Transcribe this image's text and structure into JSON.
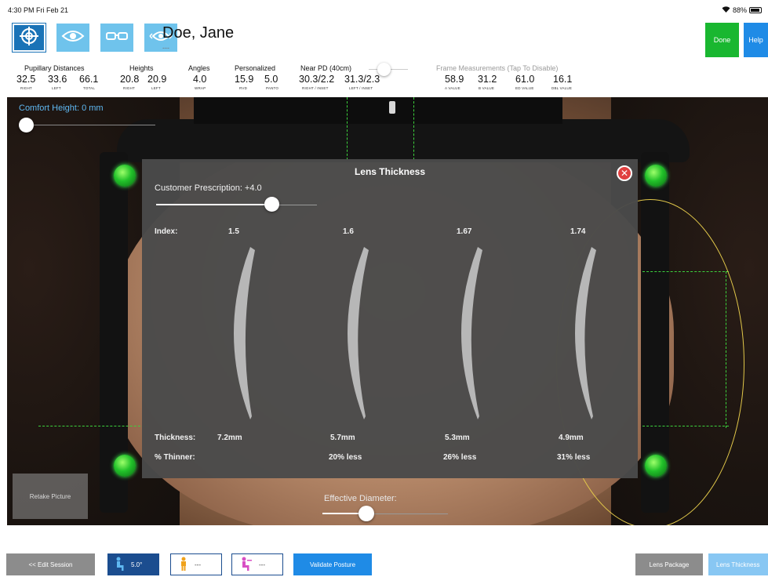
{
  "status": {
    "time": "4:30 PM  Fri Feb 21",
    "battery": "88%",
    "battery_level": 0.88
  },
  "header": {
    "patient_name": "Doe, Jane",
    "patient_sub": "---",
    "mode_tabs": [
      "target-icon",
      "eye-icon",
      "glasses-icon",
      "eye-arrows-icon"
    ],
    "done_label": "Done",
    "help_label": "Help"
  },
  "measurements": {
    "pd": {
      "title": "Pupillary Distances",
      "values": [
        "32.5",
        "33.6",
        "66.1"
      ],
      "subs": [
        "RIGHT",
        "LEFT",
        "TOTAL"
      ]
    },
    "heights": {
      "title": "Heights",
      "values": [
        "20.8",
        "20.9"
      ],
      "subs": [
        "RIGHT",
        "LEFT"
      ]
    },
    "angles": {
      "title": "Angles",
      "values": [
        "4.0"
      ],
      "subs": [
        "WRAP"
      ]
    },
    "personalized": {
      "title": "Personalized",
      "values": [
        "15.9",
        "5.0"
      ],
      "subs": [
        "RVD",
        "PANTO"
      ]
    },
    "near": {
      "title": "Near PD (40cm)",
      "values": [
        "30.3/2.2",
        "31.3/2.3"
      ],
      "subs": [
        "RIGHT / INSET",
        "LEFT / INSET"
      ]
    },
    "frame": {
      "title": "Frame Measurements (Tap To Disable)",
      "values": [
        "58.9",
        "31.2",
        "61.0",
        "16.1"
      ],
      "subs": [
        "A VALUE",
        "B VALUE",
        "ED VALUE",
        "DBL VALUE"
      ]
    }
  },
  "comfort_height_label": "Comfort Height: 0 mm",
  "retake_label": "Retake Picture",
  "effective_diameter_label": "Effective Diameter:",
  "modal": {
    "title": "Lens Thickness",
    "prescription_label": "Customer Prescription: +4.0",
    "prescription_fraction": 0.72,
    "index_label": "Index:",
    "thickness_label": "Thickness:",
    "thinner_label": "% Thinner:",
    "lenses": [
      {
        "index": "1.5",
        "thickness": "7.2mm",
        "thinner": "",
        "thickness_mm": 7.2
      },
      {
        "index": "1.6",
        "thickness": "5.7mm",
        "thinner": "20% less",
        "thickness_mm": 5.7
      },
      {
        "index": "1.67",
        "thickness": "5.3mm",
        "thinner": "26% less",
        "thickness_mm": 5.3
      },
      {
        "index": "1.74",
        "thickness": "4.9mm",
        "thinner": "31% less",
        "thickness_mm": 4.9
      }
    ]
  },
  "bottom": {
    "edit_session": "<< Edit Session",
    "posture_values": [
      "5.0°",
      "---",
      "---"
    ],
    "validate_posture": "Validate Posture",
    "lens_package": "Lens Package",
    "lens_thickness": "Lens Thickness"
  },
  "colors": {
    "accent_blue": "#1f8be6",
    "done_green": "#19b730",
    "tab_light": "#6fc3ec",
    "tab_active": "#1a73b7",
    "indicator_green": "#22c22a"
  }
}
